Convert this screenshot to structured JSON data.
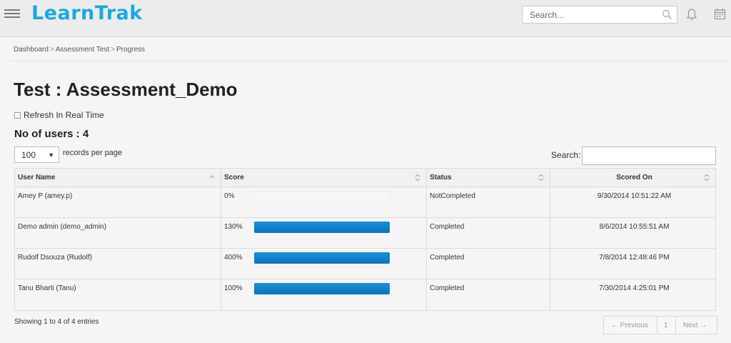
{
  "header": {
    "logo": "LearnTrak",
    "search_placeholder": "Search..."
  },
  "breadcrumb": {
    "items": [
      "Dashboard",
      "Assessment Test",
      "Progress"
    ],
    "separator": ">"
  },
  "page": {
    "title": "Test : Assessment_Demo",
    "refresh_label": "Refresh In Real Time",
    "users_count": "No of users : 4"
  },
  "controls": {
    "length_value": "100",
    "length_label": "records per page",
    "search_label": "Search:"
  },
  "table": {
    "columns": [
      "User Name",
      "Score",
      "Status",
      "Scored On"
    ],
    "rows": [
      {
        "user": "Amey P (amey.p)",
        "score": "0%",
        "score_fraction": 0.0,
        "status": "NotCompleted",
        "scored_on": "9/30/2014 10:51:22 AM"
      },
      {
        "user": "Demo admin (demo_admin)",
        "score": "130%",
        "score_fraction": 1.0,
        "status": "Completed",
        "scored_on": "8/6/2014 10:55:51 AM"
      },
      {
        "user": "Rudolf Dsouza (Rudolf)",
        "score": "400%",
        "score_fraction": 1.0,
        "status": "Completed",
        "scored_on": "7/8/2014 12:48:46 PM"
      },
      {
        "user": "Tanu Bharti (Tanu)",
        "score": "100%",
        "score_fraction": 1.0,
        "status": "Completed",
        "scored_on": "7/30/2014 4:25:01 PM"
      }
    ]
  },
  "footer": {
    "info": "Showing 1 to 4 of 4 entries",
    "prev": "← Previous",
    "page": "1",
    "next": "Next →"
  },
  "colors": {
    "logo": "#1ea7e0",
    "progress_bar": "#0f7fc8"
  }
}
